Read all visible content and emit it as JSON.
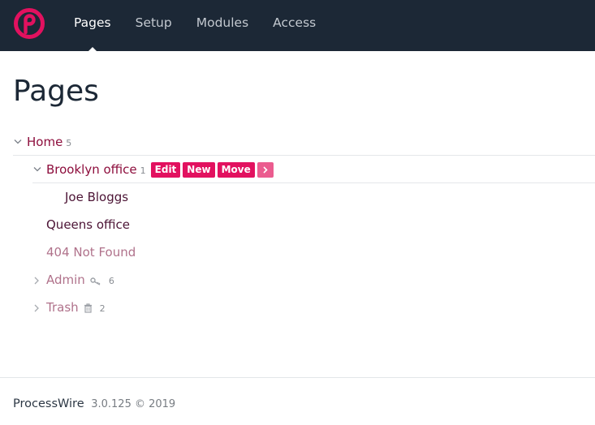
{
  "colors": {
    "topbar": "#1c2836",
    "accent": "#e2115f",
    "link": "#8d0d3c"
  },
  "brand": {
    "logo_icon": "processwire-logo-icon"
  },
  "nav": [
    {
      "label": "Pages",
      "active": true
    },
    {
      "label": "Setup",
      "active": false
    },
    {
      "label": "Modules",
      "active": false
    },
    {
      "label": "Access",
      "active": false
    }
  ],
  "page_title": "Pages",
  "tree": {
    "home": {
      "title": "Home",
      "count": "5",
      "icon": "chevron-down-icon"
    },
    "brooklyn": {
      "title": "Brooklyn office",
      "count": "1",
      "icon": "chevron-down-icon",
      "actions": {
        "edit": "Edit",
        "new": "New",
        "move": "Move",
        "more_icon": "chevron-right-icon"
      }
    },
    "joe": {
      "title": "Joe Bloggs"
    },
    "queens": {
      "title": "Queens office"
    },
    "notfound": {
      "title": "404 Not Found"
    },
    "admin": {
      "title": "Admin",
      "count": "6",
      "icon": "chevron-right-icon",
      "badge_icon": "key-icon"
    },
    "trash": {
      "title": "Trash",
      "count": "2",
      "icon": "chevron-right-icon",
      "badge_icon": "trash-icon"
    }
  },
  "footer": {
    "brand": "ProcessWire",
    "version": "3.0.125 © 2019"
  }
}
